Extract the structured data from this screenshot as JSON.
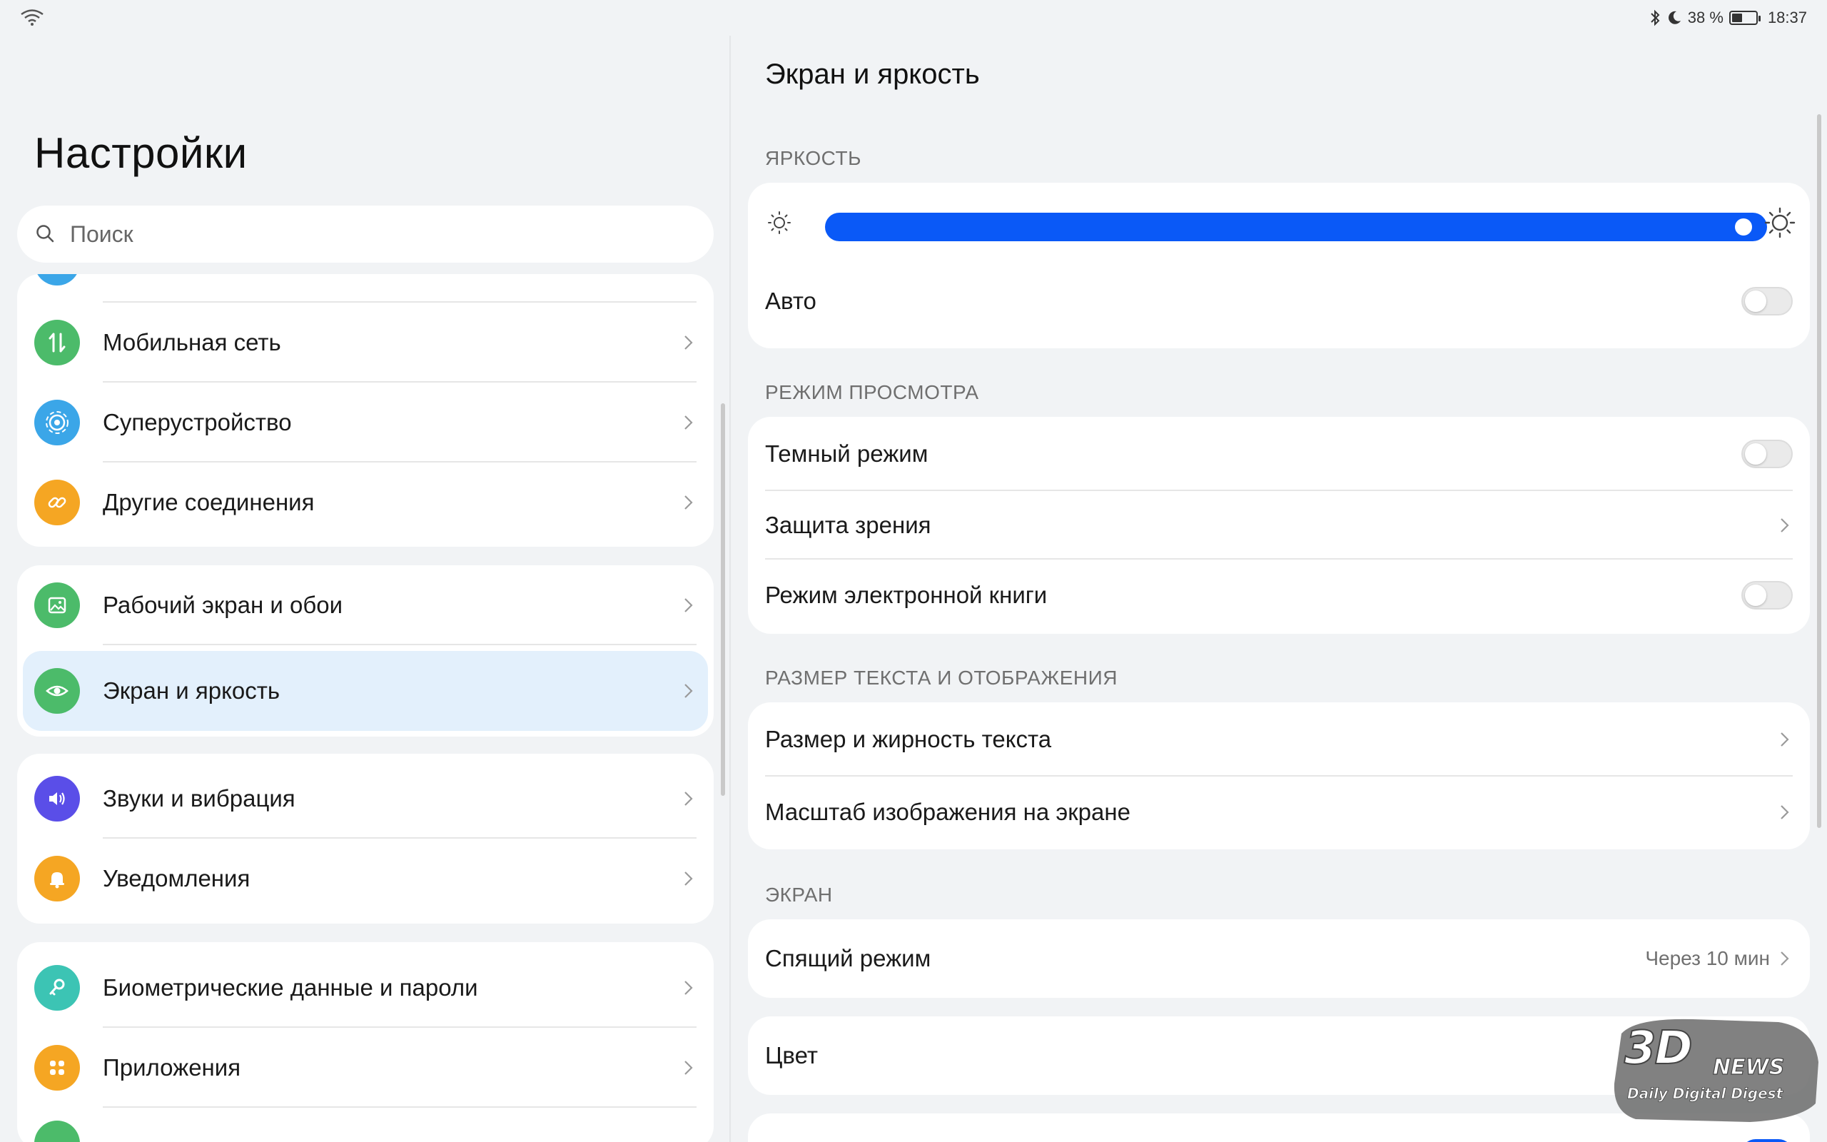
{
  "status_bar": {
    "battery_percent": "38 %",
    "time": "18:37"
  },
  "left": {
    "title": "Настройки",
    "search_placeholder": "Поиск",
    "groups": [
      {
        "items": [
          {
            "label": "Мобильная сеть",
            "icon": "mobile-data-icon",
            "color": "#4cbb6a"
          },
          {
            "label": "Суперустройство",
            "icon": "super-device-icon",
            "color": "#3ba6e8"
          },
          {
            "label": "Другие соединения",
            "icon": "link-icon",
            "color": "#f5a623"
          }
        ]
      },
      {
        "items": [
          {
            "label": "Рабочий экран и обои",
            "icon": "wallpaper-icon",
            "color": "#4cbb6a"
          },
          {
            "label": "Экран и яркость",
            "icon": "eye-icon",
            "color": "#4cbb6a",
            "active": true
          }
        ]
      },
      {
        "items": [
          {
            "label": "Звуки и вибрация",
            "icon": "sound-icon",
            "color": "#5a4ee8"
          },
          {
            "label": "Уведомления",
            "icon": "bell-icon",
            "color": "#f5a623"
          }
        ]
      },
      {
        "items": [
          {
            "label": "Биометрические данные и пароли",
            "icon": "key-icon",
            "color": "#3cc4b4"
          },
          {
            "label": "Приложения",
            "icon": "apps-icon",
            "color": "#f5a623"
          }
        ]
      }
    ]
  },
  "right": {
    "title": "Экран и яркость",
    "brightness": {
      "section": "ЯРКОСТЬ",
      "level": 0.99,
      "auto_label": "Авто",
      "auto_on": false
    },
    "view_mode": {
      "section": "РЕЖИМ ПРОСМОТРА",
      "dark_mode": "Темный режим",
      "eye_comfort": "Защита зрения",
      "ebook_mode": "Режим электронной книги"
    },
    "text_size": {
      "section": "РАЗМЕР ТЕКСТА И ОТОБРАЖЕНИЯ",
      "font_size": "Размер и жирность текста",
      "display_zoom": "Масштаб изображения на экране"
    },
    "screen": {
      "section": "ЭКРАН",
      "sleep": "Спящий режим",
      "sleep_value": "Через 10 мин",
      "color": "Цвет"
    }
  },
  "watermark": {
    "logo": "3DNEWS",
    "tagline": "Daily Digital Digest"
  },
  "colors": {
    "accent": "#0a59f7",
    "active_row": "#e3f0fc",
    "background": "#f1f3f5"
  }
}
